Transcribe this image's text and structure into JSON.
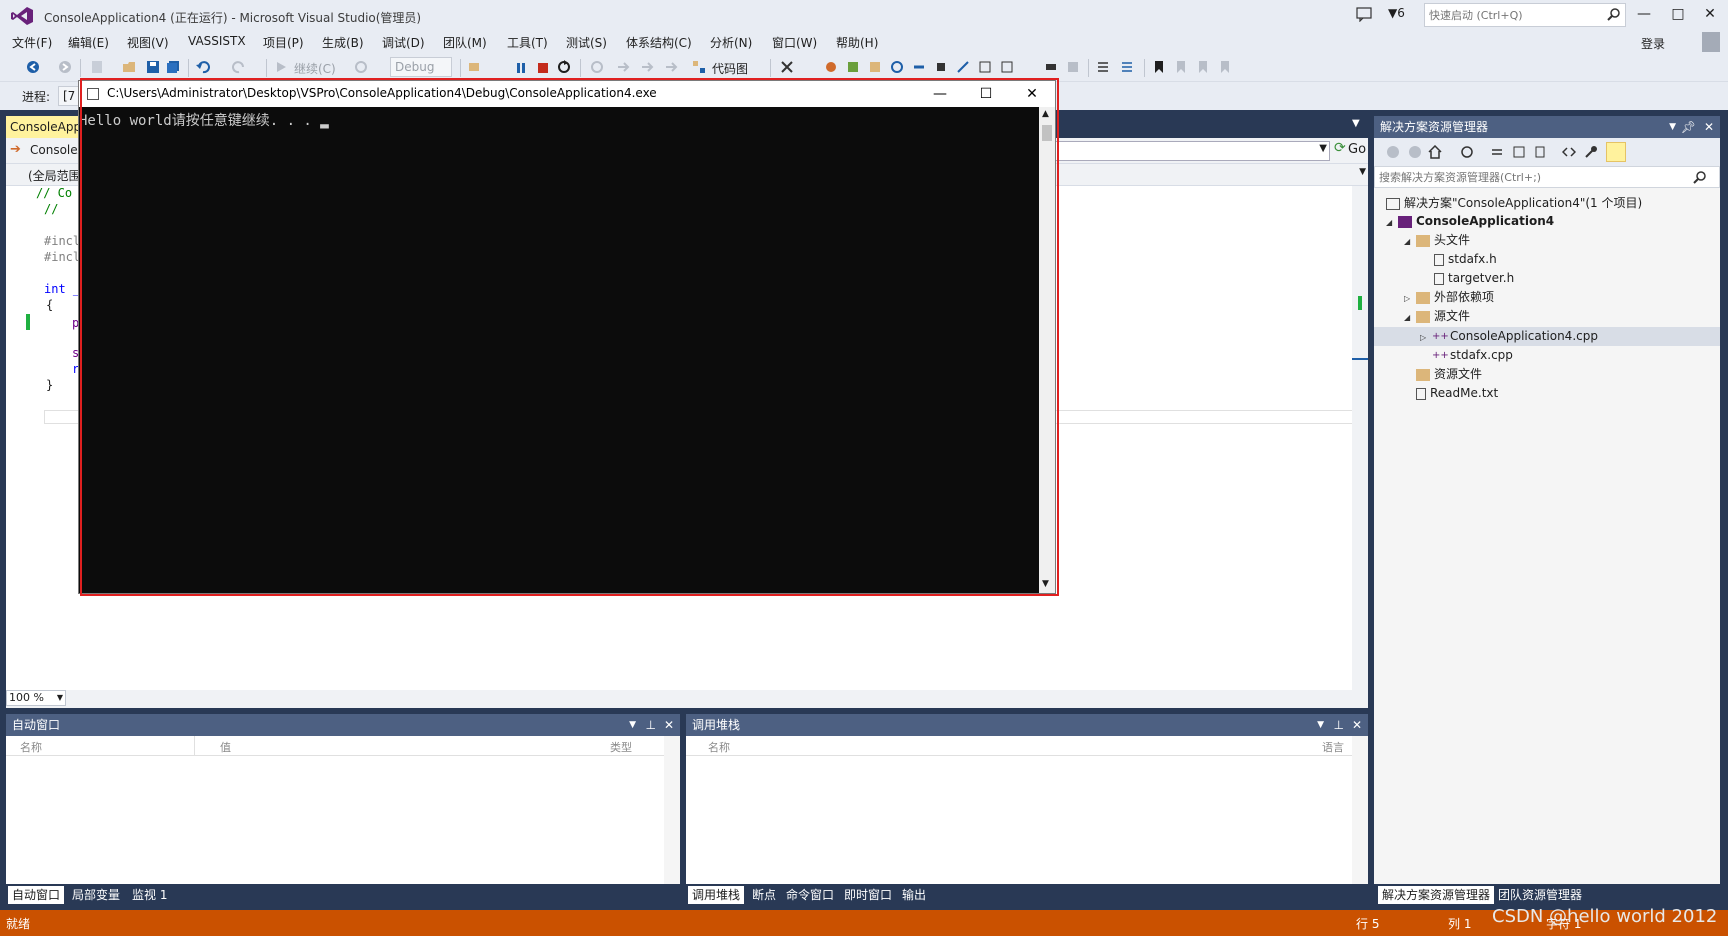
{
  "window": {
    "title": "ConsoleApplication4 (正在运行) - Microsoft Visual Studio(管理员)",
    "notification_count": "6",
    "quick_launch_placeholder": "快速启动 (Ctrl+Q)",
    "minimize": "—",
    "maximize": "□",
    "close": "✕"
  },
  "menu": {
    "items": [
      "文件(F)",
      "编辑(E)",
      "视图(V)",
      "VASSISTX",
      "项目(P)",
      "生成(B)",
      "调试(D)",
      "团队(M)",
      "工具(T)",
      "测试(S)",
      "体系结构(C)",
      "分析(N)",
      "窗口(W)",
      "帮助(H)"
    ],
    "login": "登录"
  },
  "toolbar": {
    "continue_label": "继续(C)",
    "config_value": "Debug",
    "codemap_label": "代码图",
    "progress_label": "进程:",
    "progress_value": "[7"
  },
  "document": {
    "tab_label": "ConsoleApplication4.cpp",
    "nav_project": "ConsoleApplication4",
    "nav_scope": "(全局范围)",
    "go_label": "Go",
    "zoom": "100 %",
    "code_lines": [
      "// Co",
      "//",
      "#incl",
      "#incl",
      "int _",
      "{",
      "p",
      "s",
      "r",
      "}"
    ]
  },
  "console": {
    "title": "C:\\Users\\Administrator\\Desktop\\VSPro\\ConsoleApplication4\\Debug\\ConsoleApplication4.exe",
    "output": "Hello world请按任意键继续. . . ",
    "cursor": "▂",
    "minimize": "—",
    "maximize": "☐",
    "close": "✕"
  },
  "solution_explorer": {
    "title": "解决方案资源管理器",
    "search_placeholder": "搜索解决方案资源管理器(Ctrl+;)",
    "nodes": [
      {
        "label": "解决方案\"ConsoleApplication4\"(1 个项目)"
      },
      {
        "label": "ConsoleApplication4"
      },
      {
        "label": "头文件"
      },
      {
        "label": "stdafx.h"
      },
      {
        "label": "targetver.h"
      },
      {
        "label": "外部依赖项"
      },
      {
        "label": "源文件"
      },
      {
        "label": "ConsoleApplication4.cpp"
      },
      {
        "label": "stdafx.cpp"
      },
      {
        "label": "资源文件"
      },
      {
        "label": "ReadMe.txt"
      }
    ],
    "bottom_tabs": [
      "解决方案资源管理器",
      "团队资源管理器"
    ]
  },
  "autos": {
    "title": "自动窗口",
    "columns": [
      "名称",
      "值",
      "类型"
    ],
    "tabs": [
      "自动窗口",
      "局部变量",
      "监视 1"
    ]
  },
  "callstack": {
    "title": "调用堆栈",
    "columns": [
      "名称",
      "语言"
    ],
    "tabs": [
      "调用堆栈",
      "断点",
      "命令窗口",
      "即时窗口",
      "输出"
    ]
  },
  "status": {
    "ready": "就绪",
    "line": "行 5",
    "col": "列 1",
    "char": "字符 1"
  },
  "watermark": "CSDN @hello world 2012",
  "colors": {
    "titlebar_bg": "#e8ecf3",
    "panel_header": "#4d6082",
    "statusbar": "#ca5100",
    "console_bg": "#0c0c0c",
    "highlight_box": "#e02020",
    "active_doc_tab": "#fff29d"
  }
}
